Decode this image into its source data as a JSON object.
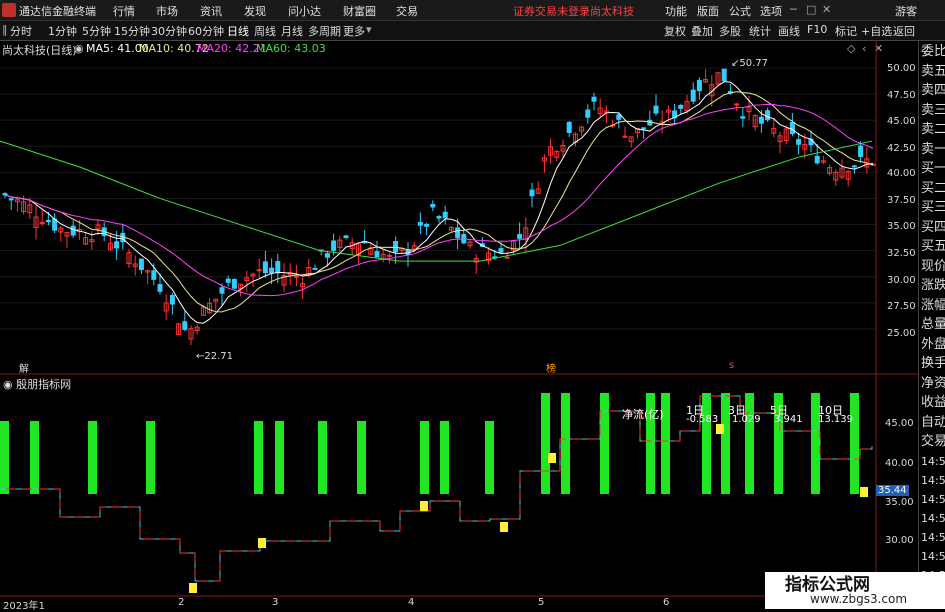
{
  "menu": {
    "app_name": "通达信金融终端",
    "items": [
      "行情",
      "市场",
      "资讯",
      "发现",
      "问小达",
      "财富圈",
      "交易"
    ],
    "notice": "证券交易未登录",
    "notice_stock": "尚太科技",
    "right_items": [
      "功能",
      "版面",
      "公式",
      "选项"
    ],
    "user": "游客"
  },
  "toolbar": {
    "periods": [
      "分时",
      "1分钟",
      "5分钟",
      "15分钟",
      "30分钟",
      "60分钟",
      "日线",
      "周线",
      "月线",
      "多周期",
      "更多"
    ],
    "active": "日线",
    "right_tools": [
      "复权",
      "叠加",
      "多股",
      "统计",
      "画线",
      "F10",
      "标记",
      "+自选",
      "返回"
    ]
  },
  "ma": {
    "title": "尚太科技(日线)",
    "ma5": "MA5: 41.00",
    "ma10": "MA10: 40.72",
    "ma20": "MA20: 42.21",
    "ma60": "MA60: 43.03",
    "colors": {
      "ma5": "#ffffff",
      "ma10": "#f0e68c",
      "ma20": "#ff40ff",
      "ma60": "#40e040"
    }
  },
  "price_axis": [
    "50.00",
    "47.50",
    "45.00",
    "42.50",
    "40.00",
    "37.50",
    "35.00",
    "32.50",
    "30.00",
    "27.50",
    "25.00"
  ],
  "annotations": {
    "high": "50.77",
    "low": "22.71",
    "jie": "解",
    "bang": "榜",
    "s": "s"
  },
  "indicator": {
    "title": "殷朋指标网",
    "label_net": "净流(亿)",
    "label_1d": "1日",
    "label_3d": "3日",
    "label_5d": "5日",
    "label_10d": "10日",
    "val_1d": "-0.583",
    "val_3d": "1.029",
    "val_5d": "3.941",
    "val_10d": "13.139",
    "axis": [
      "45.00",
      "40.00",
      "35.00",
      "30.00"
    ],
    "current": "35.44"
  },
  "date_axis": [
    "2023年1",
    "2",
    "3",
    "4",
    "5",
    "6"
  ],
  "right_panel": {
    "items": [
      "委比",
      "卖五",
      "卖四",
      "卖三",
      "卖二",
      "卖一",
      "买一",
      "买二",
      "买三",
      "买四",
      "买五",
      "现价",
      "涨跌",
      "涨幅",
      "总量",
      "外盘",
      "换手",
      "净资",
      "收益",
      "自动",
      "交易"
    ],
    "times": [
      "14:56",
      "14:56",
      "14:56",
      "14:56",
      "14:56",
      "14:56",
      "14:56",
      "14:56"
    ]
  },
  "watermark": {
    "title": "指标公式网",
    "url": "www.zbgs3.com"
  }
}
